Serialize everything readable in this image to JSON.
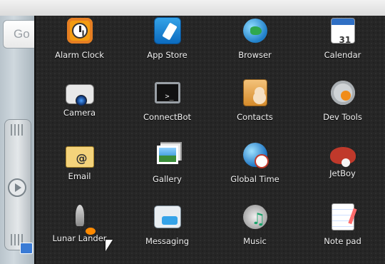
{
  "left_home": {
    "search_text": "Go"
  },
  "drawer": {
    "apps": [
      {
        "label": "Alarm Clock",
        "icon": "alarm-clock-icon"
      },
      {
        "label": "App Store",
        "icon": "app-store-icon"
      },
      {
        "label": "Browser",
        "icon": "browser-icon"
      },
      {
        "label": "Calendar",
        "icon": "calendar-icon"
      },
      {
        "label": "Camera",
        "icon": "camera-icon"
      },
      {
        "label": "ConnectBot",
        "icon": "terminal-icon"
      },
      {
        "label": "Contacts",
        "icon": "contacts-icon"
      },
      {
        "label": "Dev Tools",
        "icon": "dev-tools-icon"
      },
      {
        "label": "Email",
        "icon": "email-icon"
      },
      {
        "label": "Gallery",
        "icon": "gallery-icon"
      },
      {
        "label": "Global Time",
        "icon": "global-time-icon"
      },
      {
        "label": "JetBoy",
        "icon": "jetboy-icon"
      },
      {
        "label": "Lunar Lander",
        "icon": "lunar-lander-icon"
      },
      {
        "label": "Messaging",
        "icon": "messaging-icon"
      },
      {
        "label": "Music",
        "icon": "music-icon"
      },
      {
        "label": "Note pad",
        "icon": "note-pad-icon"
      }
    ]
  }
}
